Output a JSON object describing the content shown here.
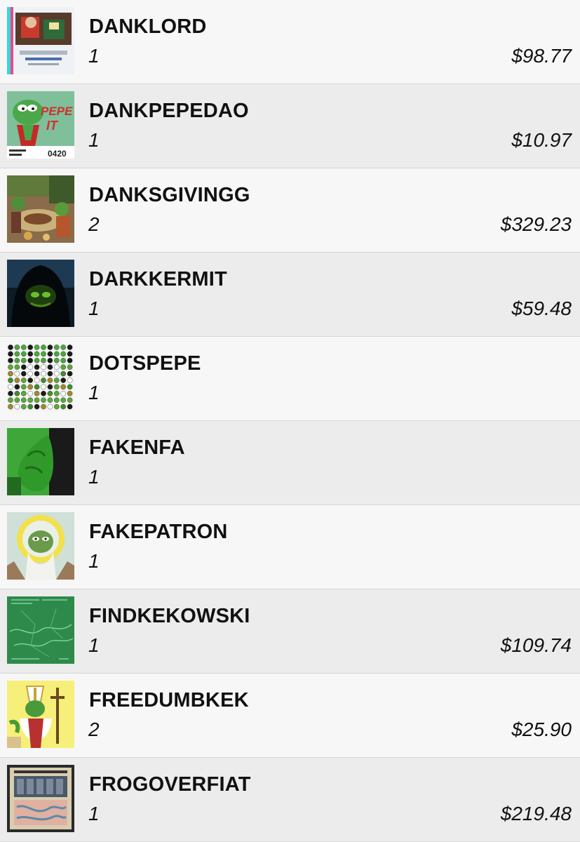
{
  "items": [
    {
      "name": "DANKLORD",
      "qty": "1",
      "price": "$98.77",
      "thumb_icon": "danklord-card-image"
    },
    {
      "name": "DANKPEPEDAO",
      "qty": "1",
      "price": "$10.97",
      "thumb_icon": "pepe-it-card-image",
      "thumb_text": [
        "PEPE",
        "IT",
        "0420"
      ]
    },
    {
      "name": "DANKSGIVINGG",
      "qty": "2",
      "price": "$329.23",
      "thumb_icon": "thanksgiving-scene-image"
    },
    {
      "name": "DARKKERMIT",
      "qty": "1",
      "price": "$59.48",
      "thumb_icon": "hooded-frog-image"
    },
    {
      "name": "DOTSPEPE",
      "qty": "1",
      "price": "",
      "thumb_icon": "dot-grid-pepe-image"
    },
    {
      "name": "FAKENFA",
      "qty": "1",
      "price": "",
      "thumb_icon": "green-hand-image"
    },
    {
      "name": "FAKEPATRON",
      "qty": "1",
      "price": "",
      "thumb_icon": "haloed-frog-saint-image"
    },
    {
      "name": "FINDKEKOWSKI",
      "qty": "1",
      "price": "$109.74",
      "thumb_icon": "green-map-image"
    },
    {
      "name": "FREEDUMBKEK",
      "qty": "2",
      "price": "$25.90",
      "thumb_icon": "frog-pope-image"
    },
    {
      "name": "FROGOVERFIAT",
      "qty": "1",
      "price": "$219.48",
      "thumb_icon": "frog-over-fiat-card-image"
    }
  ]
}
